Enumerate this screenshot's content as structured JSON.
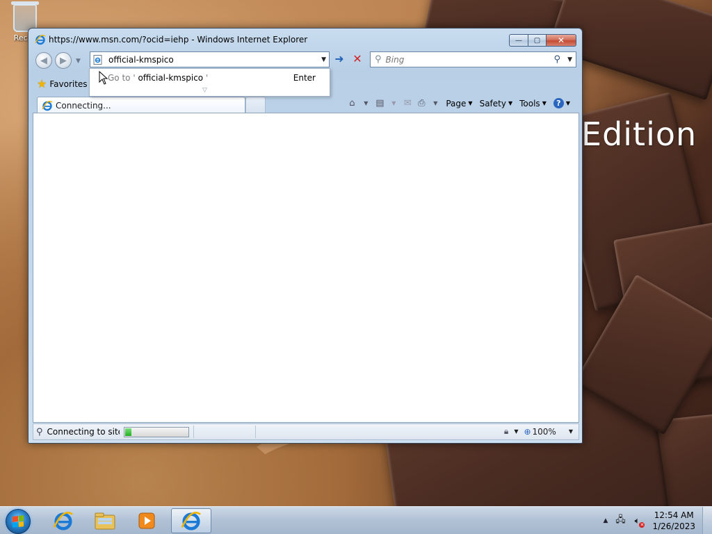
{
  "desktop": {
    "recycle_bin_label": "Recyc",
    "wallpaper_text": "Edition"
  },
  "window": {
    "title": "https://www.msn.com/?ocid=iehp - Windows Internet Explorer",
    "controls": {
      "minimize": "—",
      "maximize": "▢",
      "close": "✕"
    }
  },
  "nav": {
    "address_value": "official-kmspico",
    "search_placeholder": "Bing"
  },
  "autocomplete": {
    "prefix": "Go to '",
    "term": "official-kmspico",
    "suffix": " '",
    "enter_label": "Enter"
  },
  "favorites": {
    "label": "Favorites"
  },
  "tab": {
    "label": "Connecting..."
  },
  "commandbar": {
    "page": "Page",
    "safety": "Safety",
    "tools": "Tools"
  },
  "status": {
    "text": "Connecting to site",
    "progress": 0.1,
    "zoom": "100%"
  },
  "taskbar": {
    "time": "12:54 AM",
    "date": "1/26/2023"
  },
  "colors": {
    "accent": "#2464b8",
    "stop": "#d42020",
    "progress": "#20b020"
  }
}
